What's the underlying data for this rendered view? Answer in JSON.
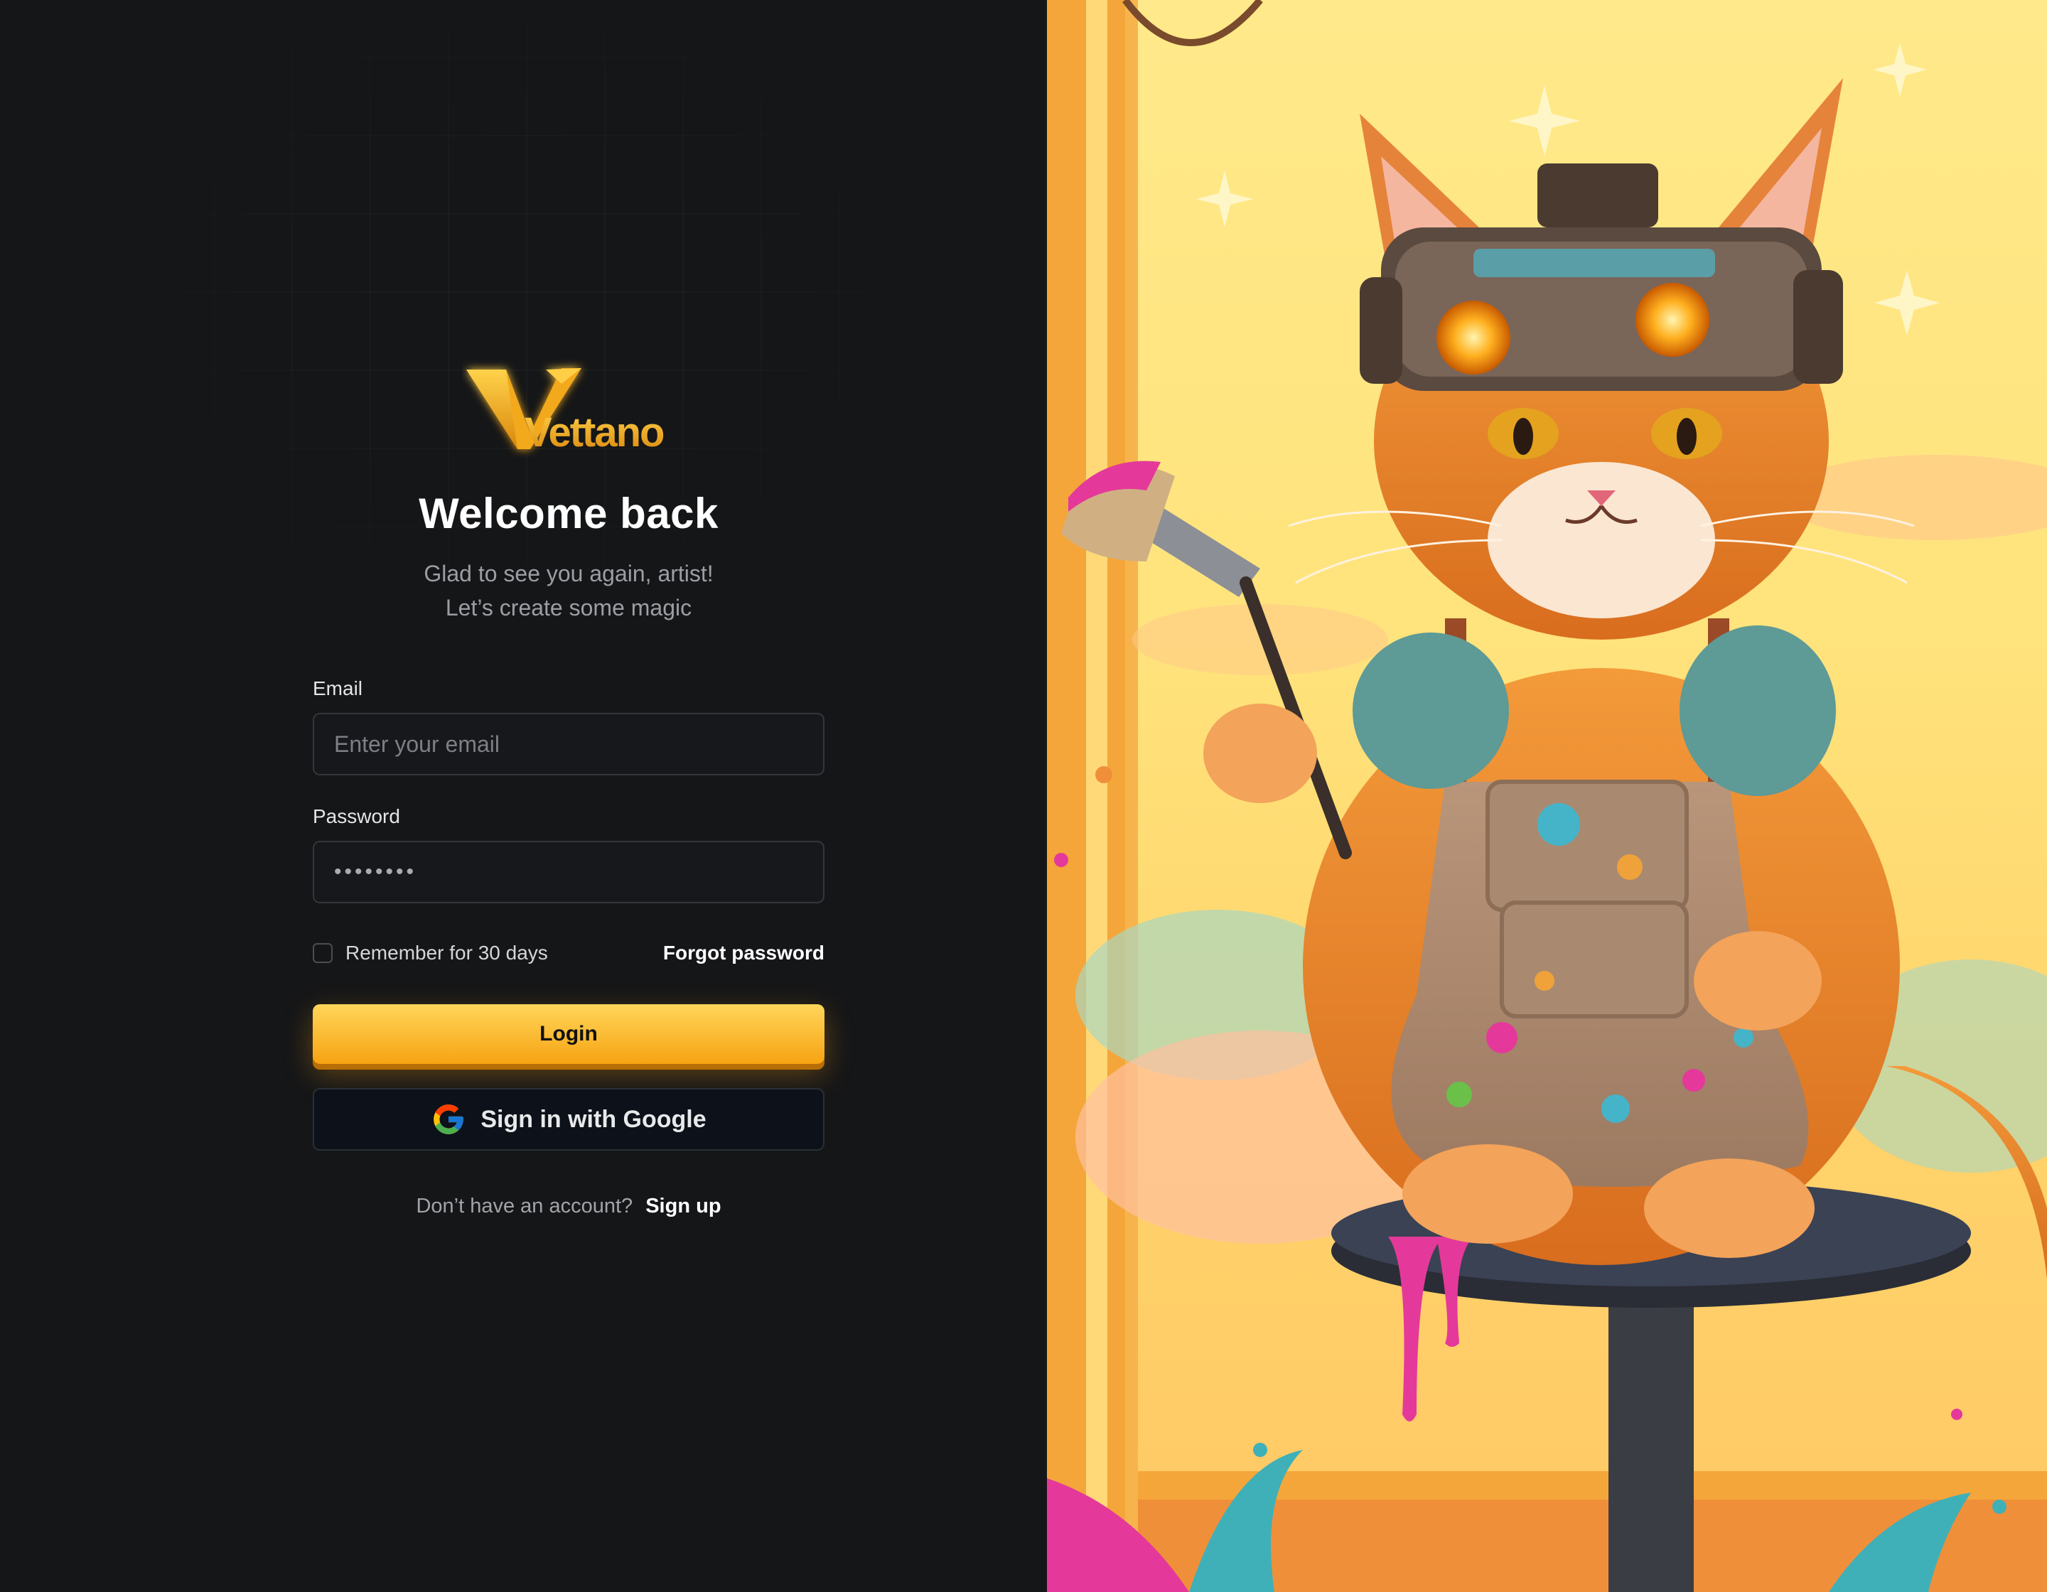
{
  "brand": {
    "name": "Vettano"
  },
  "login": {
    "title": "Welcome back",
    "subtitle_line1": "Glad to see you again, artist!",
    "subtitle_line2": "Let’s create some magic",
    "email_label": "Email",
    "email_placeholder": "Enter your email",
    "password_label": "Password",
    "password_value": "••••••••",
    "remember_label": "Remember for 30 days",
    "forgot_label": "Forgot password",
    "login_button": "Login",
    "google_button": "Sign in with Google",
    "signup_prompt": "Don’t have an account?",
    "signup_link": "Sign up"
  },
  "colors": {
    "background": "#151618",
    "accent": "#f9b42a",
    "input_border": "#34363b"
  },
  "icons": {
    "google": "google-logo-icon",
    "checkbox": "checkbox-unchecked-icon"
  }
}
